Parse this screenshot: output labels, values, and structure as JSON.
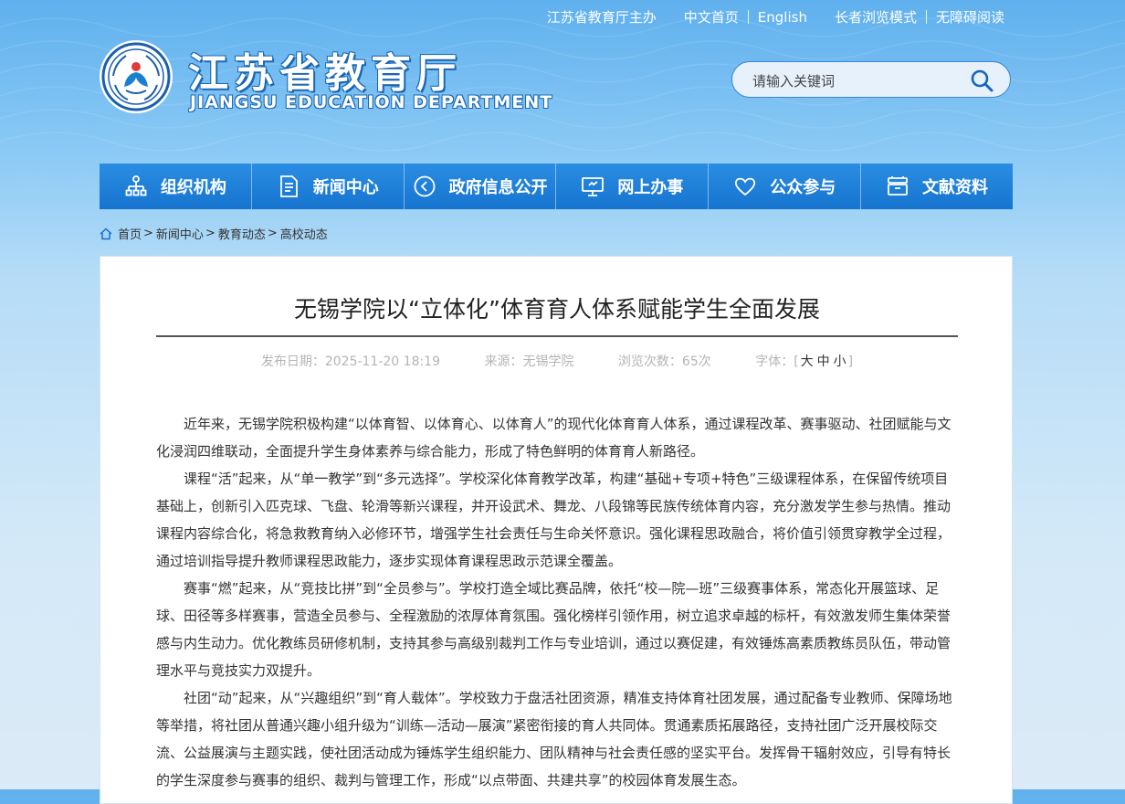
{
  "header": {
    "top_links": {
      "sponsor": "江苏省教育厅主办",
      "chinese_home": "中文首页",
      "english": "English",
      "elderly_mode": "长者浏览模式",
      "accessibility": "无障碍阅读"
    },
    "logo_cn": "江苏省教育厅",
    "logo_en": "JIANGSU EDUCATION DEPARTMENT",
    "search": {
      "placeholder": "请输入关键词",
      "icon": "search-icon"
    }
  },
  "nav": {
    "items": [
      {
        "label": "组织机构",
        "icon": "org-chart-icon"
      },
      {
        "label": "新闻中心",
        "icon": "document-icon"
      },
      {
        "label": "政府信息公开",
        "icon": "play-icon"
      },
      {
        "label": "网上办事",
        "icon": "monitor-icon"
      },
      {
        "label": "公众参与",
        "icon": "heart-icon"
      },
      {
        "label": "文献资料",
        "icon": "archive-icon"
      }
    ]
  },
  "breadcrumb": {
    "icon": "home-icon",
    "items": [
      "首页",
      "新闻中心",
      "教育动态",
      "高校动态"
    ],
    "separator": ">"
  },
  "article": {
    "title": "无锡学院以“立体化”体育育人体系赋能学生全面发展",
    "meta": {
      "date_label": "发布日期：",
      "date": "2025-11-20 18:19",
      "source_label": "来源：",
      "source": "无锡学院",
      "views_label": "浏览次数：",
      "views": "65次",
      "font_label": "字体：",
      "font_large": "大",
      "font_medium": "中",
      "font_small": "小"
    },
    "paragraphs": [
      "近年来，无锡学院积极构建“以体育智、以体育心、以体育人”的现代化体育育人体系，通过课程改革、赛事驱动、社团赋能与文化浸润四维联动，全面提升学生身体素养与综合能力，形成了特色鲜明的体育育人新路径。",
      "课程“活”起来，从“单一教学”到“多元选择”。学校深化体育教学改革，构建“基础+专项+特色”三级课程体系，在保留传统项目基础上，创新引入匹克球、飞盘、轮滑等新兴课程，并开设武术、舞龙、八段锦等民族传统体育内容，充分激发学生参与热情。推动课程内容综合化，将急救教育纳入必修环节，增强学生社会责任与生命关怀意识。强化课程思政融合，将价值引领贯穿教学全过程，通过培训指导提升教师课程思政能力，逐步实现体育课程思政示范课全覆盖。",
      "赛事“燃”起来，从“竞技比拼”到“全员参与”。学校打造全域比赛品牌，依托“校—院—班”三级赛事体系，常态化开展篮球、足球、田径等多样赛事，营造全员参与、全程激励的浓厚体育氛围。强化榜样引领作用，树立追求卓越的标杆，有效激发师生集体荣誉感与内生动力。优化教练员研修机制，支持其参与高级别裁判工作与专业培训，通过以赛促建，有效锤炼高素质教练员队伍，带动管理水平与竞技实力双提升。",
      "社团“动”起来，从“兴趣组织”到“育人载体”。学校致力于盘活社团资源，精准支持体育社团发展，通过配备专业教师、保障场地等举措，将社团从普通兴趣小组升级为“训练—活动—展演”紧密衔接的育人共同体。贯通素质拓展路径，支持社团广泛开展校际交流、公益展演与主题实践，使社团活动成为锤炼学生组织能力、团队精神与社会责任感的坚实平台。发挥骨干辐射效应，引导有特长的学生深度参与赛事的组织、裁判与管理工作，形成“以点带面、共建共享”的校园体育发展生态。"
    ]
  }
}
